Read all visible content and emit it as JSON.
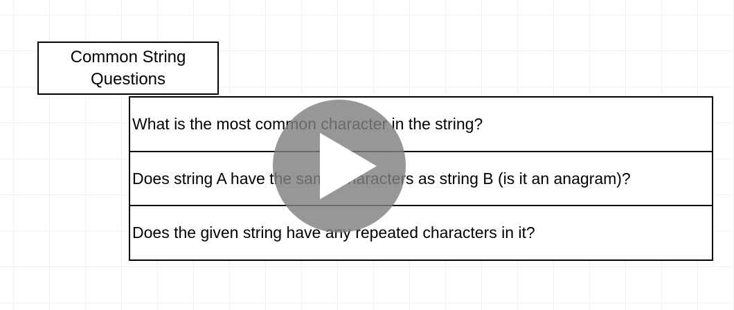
{
  "diagram": {
    "title": "Common String Questions",
    "questions": [
      "What is the most common character in the string?",
      "Does string A have the same characters as string B (is it an anagram)?",
      "Does the given string have any repeated characters in it?"
    ]
  },
  "video_overlay": {
    "play_icon": "play-icon",
    "overlay_color": "#808080"
  }
}
